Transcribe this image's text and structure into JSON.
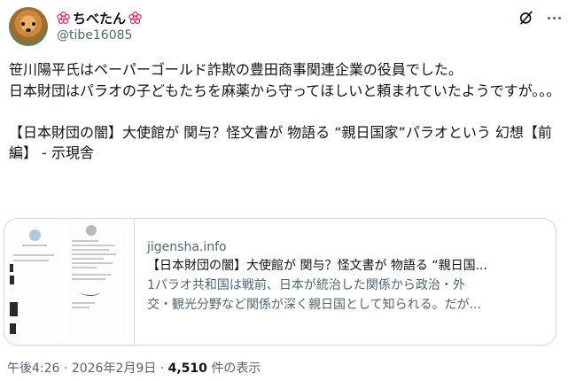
{
  "user": {
    "display_name": "ちべたん",
    "handle": "@tibe16085",
    "name_emoji": "flower-icon"
  },
  "actions": {
    "grok": "grok-icon",
    "more": "more-icon"
  },
  "tweet": {
    "text": "笹川陽平氏はペーパーゴールド詐欺の豊田商事関連企業の役員でした。\n日本財団はパラオの子どもたちを麻薬から守ってほしいと頼まれていたようですが。。。\n\n【日本財団の闇】大使館が 関与？怪文書が 物語る “親日国家”パラオという 幻想【前編】 - 示現舎"
  },
  "card": {
    "domain": "jigensha.info",
    "title": "【日本財団の闇】大使館が 関与？怪文書が 物語る “親日国...",
    "description_line1": "1パラオ共和国は戦前、日本が統治した関係から政治・外",
    "description_line2": "交・観光分野など関係が深く親日国として知られる。だが..."
  },
  "meta": {
    "time": "午後4:26",
    "separator": "·",
    "date": "2026年2月9日",
    "views_count": "4,510",
    "views_label": " 件の表示"
  },
  "colors": {
    "text": "#0f1419",
    "secondary": "#536471",
    "border": "#cfd9de",
    "flower": "#e0245e"
  }
}
